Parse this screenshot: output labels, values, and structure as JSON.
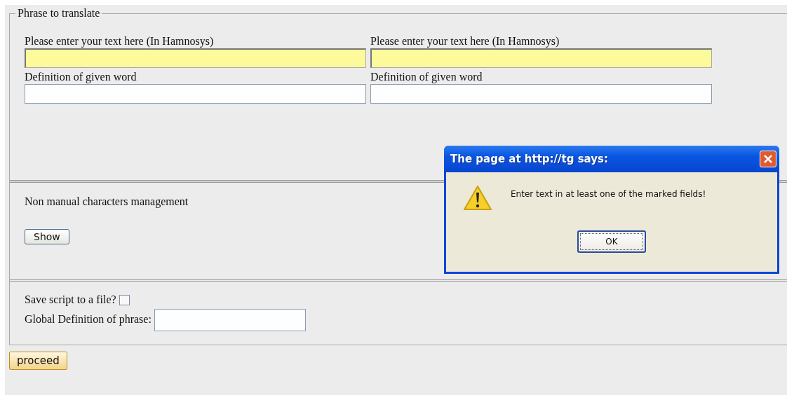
{
  "phrase_section": {
    "legend": "Phrase to translate",
    "columns": [
      {
        "text_label": "Please enter your text here (In Hamnosys)",
        "text_marked": true,
        "definition_label": "Definition of given word",
        "definition_marked": false
      },
      {
        "text_label": "Please enter your text here (In Hamnosys)",
        "text_marked": true,
        "definition_label": "Definition of given word",
        "definition_marked": false
      }
    ]
  },
  "non_manual_section": {
    "title": "Non manual characters management",
    "button": "Show"
  },
  "save_section": {
    "save_label": "Save script to a file?",
    "save_checked": false,
    "global_definition_label": "Global Definition of phrase:"
  },
  "proceed_button": "proceed",
  "dialog": {
    "title": "The page at http://tg says:",
    "message": "Enter text in at least one of the marked fields!",
    "button": "OK"
  }
}
